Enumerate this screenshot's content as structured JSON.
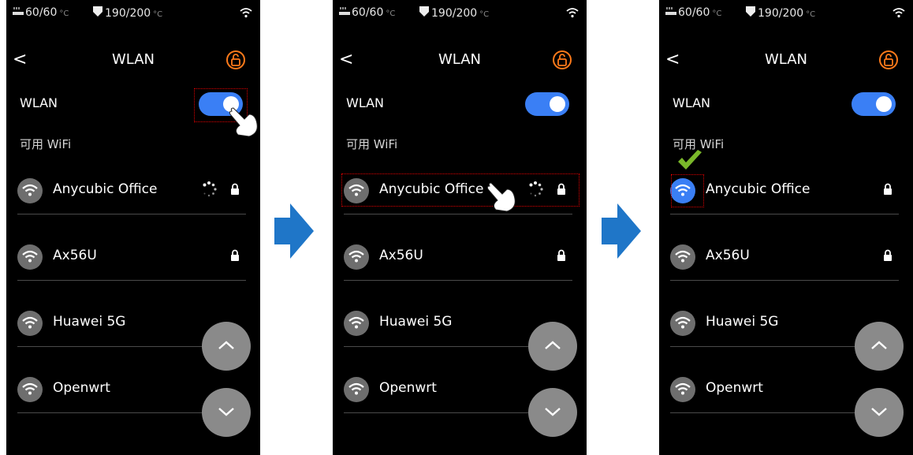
{
  "status": {
    "nozzle": "60/60",
    "nozzle_unit": "°C",
    "bed": "190/200",
    "bed_unit": "°C"
  },
  "screen": {
    "title": "WLAN",
    "wlan_label": "WLAN",
    "available_label": "可用 WiFi",
    "back": "<"
  },
  "networks": [
    {
      "name": "Anycubic Office",
      "locked": true
    },
    {
      "name": "Ax56U",
      "locked": true
    },
    {
      "name": "Huawei 5G",
      "locked": false
    },
    {
      "name": "Openwrt",
      "locked": false
    }
  ],
  "steps": [
    {
      "step": 1,
      "wlan_enabled": true,
      "connecting": "Anycubic Office"
    },
    {
      "step": 2,
      "wlan_enabled": true,
      "connecting": "Anycubic Office"
    },
    {
      "step": 3,
      "wlan_enabled": true,
      "connected": "Anycubic Office"
    }
  ],
  "colors": {
    "accent": "#3a7ff5",
    "highlight": "#e00000",
    "lock_icon": "#ff7a1a",
    "check": "#7ab82a",
    "flow_arrow": "#1f76c8"
  },
  "icons": [
    "wifi-icon",
    "lock-icon",
    "unlock-settings-icon",
    "chevron-up-icon",
    "chevron-down-icon",
    "back-icon",
    "tap-hand-icon",
    "checkmark-icon",
    "arrow-right-icon"
  ]
}
